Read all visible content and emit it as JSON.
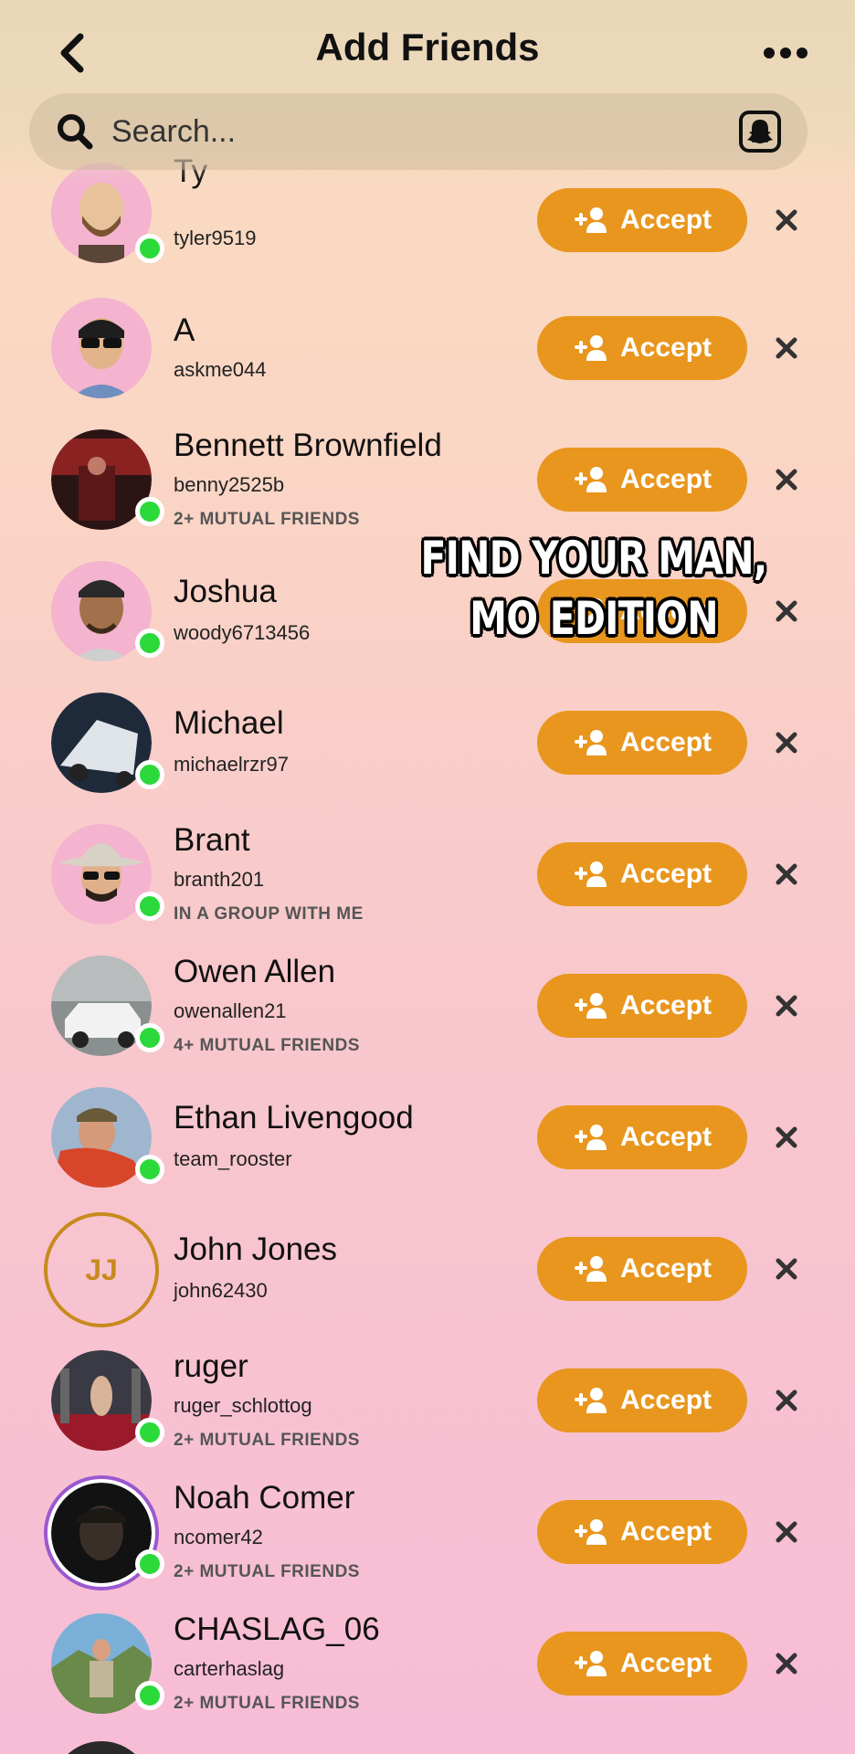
{
  "header": {
    "title": "Add Friends",
    "search_placeholder": "Search..."
  },
  "overlay": {
    "line1": "FIND YOUR MAN,",
    "line2": "MO EDITION"
  },
  "accept_label": "Accept",
  "requests": [
    {
      "name": "Ty",
      "username": "tyler9519",
      "sub": "",
      "online": true
    },
    {
      "name": "A",
      "username": "askme044",
      "sub": "",
      "online": false
    },
    {
      "name": "Bennett Brownfield",
      "username": "benny2525b",
      "sub": "2+ MUTUAL FRIENDS",
      "online": true
    },
    {
      "name": "Joshua",
      "username": "woody6713456",
      "sub": "",
      "online": true
    },
    {
      "name": "Michael",
      "username": "michaelrzr97",
      "sub": "",
      "online": true
    },
    {
      "name": "Brant",
      "username": "branth201",
      "sub": "IN A GROUP WITH ME",
      "online": true
    },
    {
      "name": "Owen Allen",
      "username": "owenallen21",
      "sub": "4+ MUTUAL FRIENDS",
      "online": true
    },
    {
      "name": "Ethan Livengood",
      "username": "team_rooster",
      "sub": "",
      "online": true
    },
    {
      "name": "John Jones",
      "username": "john62430",
      "sub": "",
      "online": false,
      "initials": "JJ"
    },
    {
      "name": "ruger",
      "username": "ruger_schlottog",
      "sub": "2+ MUTUAL FRIENDS",
      "online": true
    },
    {
      "name": "Noah Comer",
      "username": "ncomer42",
      "sub": "2+ MUTUAL FRIENDS",
      "online": true
    },
    {
      "name": "CHASLAG_06",
      "username": "carterhaslag",
      "sub": "2+ MUTUAL FRIENDS",
      "online": true
    }
  ]
}
